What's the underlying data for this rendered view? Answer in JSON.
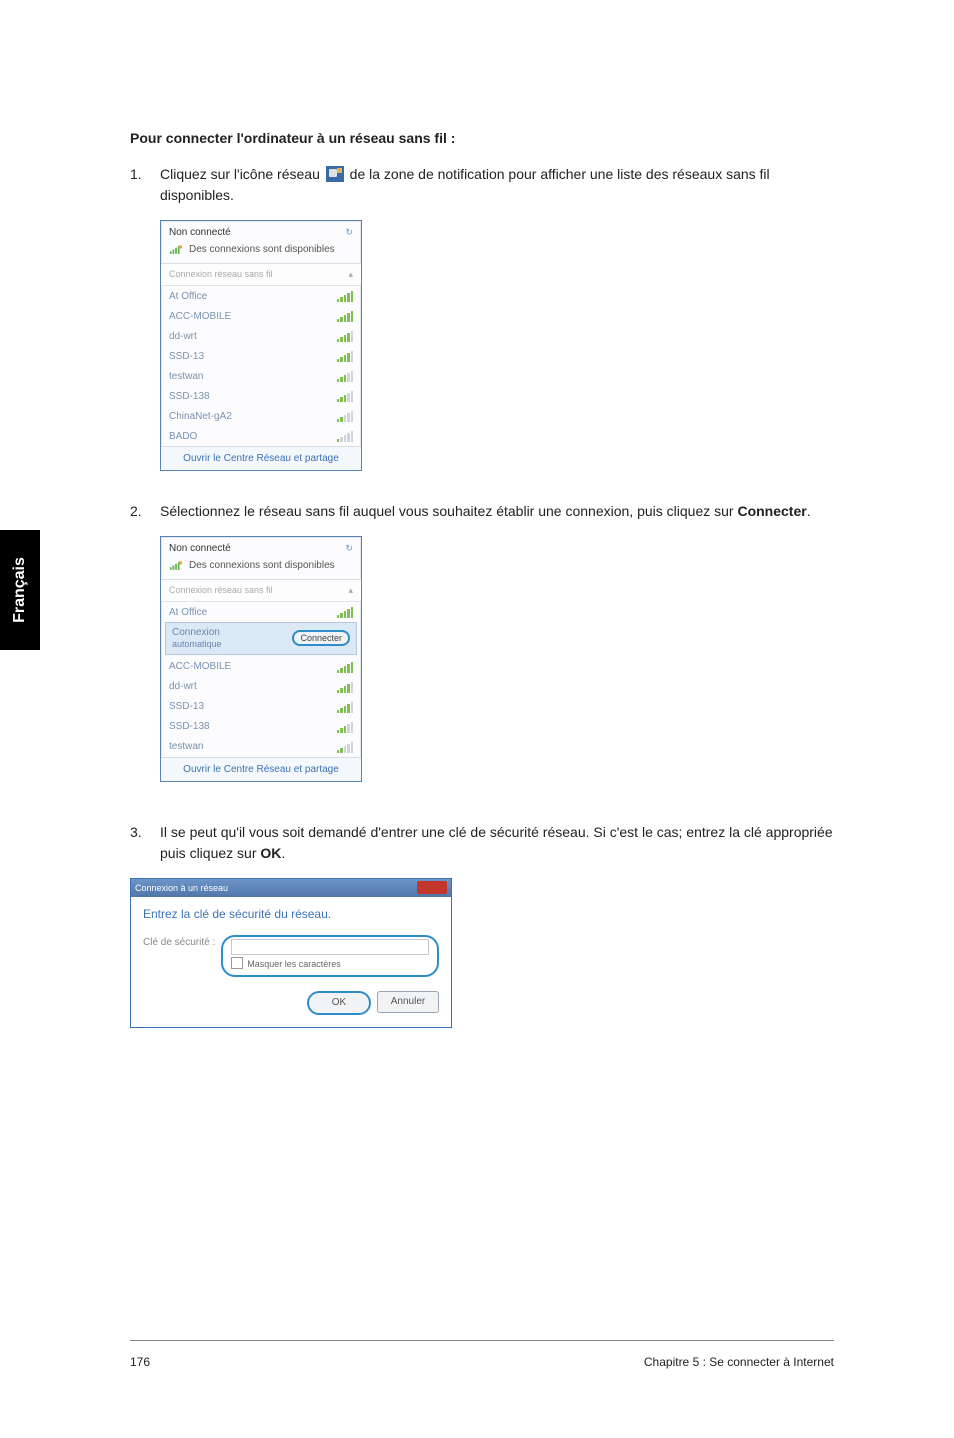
{
  "heading": "Pour connecter l'ordinateur à un réseau sans fil :",
  "side_tab": "Français",
  "steps": {
    "s1": {
      "num": "1.",
      "pre": "Cliquez sur l'icône réseau ",
      "post": " de la zone de notification pour afficher une liste des réseaux sans fil disponibles."
    },
    "s2": {
      "num": "2.",
      "text_pre": "Sélectionnez le réseau sans fil auquel vous souhaitez établir une connexion, puis cliquez sur ",
      "bold": "Connecter",
      "text_post": "."
    },
    "s3": {
      "num": "3.",
      "text_pre": "Il se peut qu'il vous soit demandé d'entrer une clé de sécurité réseau. Si c'est le cas; entrez la clé appropriée puis cliquez sur ",
      "bold": "OK",
      "text_post": "."
    }
  },
  "ss1": {
    "status": "Non connecté",
    "avail": "Des connexions sont disponibles",
    "sub": "Connexion réseau sans fil",
    "networks": [
      {
        "name": "At Office",
        "lvl": "lvl5"
      },
      {
        "name": "ACC-MOBILE",
        "lvl": "lvl5"
      },
      {
        "name": "dd-wrt",
        "lvl": "lvl4"
      },
      {
        "name": "SSD-13",
        "lvl": "lvl4"
      },
      {
        "name": "testwan",
        "lvl": "lvl3"
      },
      {
        "name": "SSD-138",
        "lvl": "lvl3"
      },
      {
        "name": "ChinaNet-gA2",
        "lvl": "lvl2"
      },
      {
        "name": "BADO",
        "lvl": "lvl1"
      }
    ],
    "link": "Ouvrir le Centre Réseau et partage"
  },
  "ss2": {
    "status": "Non connecté",
    "avail": "Des connexions sont disponibles",
    "sub": "Connexion réseau sans fil",
    "selected_name": "At Office",
    "selected_line1": "Connexion",
    "selected_line2": "automatique",
    "connect_btn": "Connecter",
    "networks": [
      {
        "name": "ACC-MOBILE",
        "lvl": "lvl5"
      },
      {
        "name": "dd-wrt",
        "lvl": "lvl4"
      },
      {
        "name": "SSD-13",
        "lvl": "lvl4"
      },
      {
        "name": "SSD-138",
        "lvl": "lvl3"
      },
      {
        "name": "testwan",
        "lvl": "lvl2"
      }
    ],
    "link": "Ouvrir le Centre Réseau et partage"
  },
  "ss3": {
    "title": "Connexion à un réseau",
    "prompt": "Entrez la clé de sécurité du réseau.",
    "label": "Clé de sécurité :",
    "mask": "Masquer les caractères",
    "ok": "OK",
    "cancel": "Annuler"
  },
  "footer": {
    "page": "176",
    "chapter": "Chapitre 5 : Se connecter à Internet"
  }
}
